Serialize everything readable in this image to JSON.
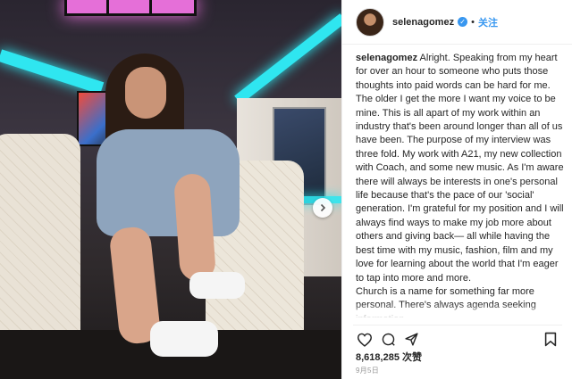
{
  "header": {
    "username": "selenagomez",
    "separator": "•",
    "follow_label": "关注"
  },
  "caption": {
    "username": "selenagomez",
    "paragraph1": "Alright. Speaking from my heart for over an hour to someone who puts those thoughts into paid words can be hard for me. The older I get the more I want my voice to be mine. This is all apart of my work within an industry that's been around longer than all of us have been. The purpose of my interview was three fold. My work with A21, my new collection with Coach, and some new music. As I'm aware there will always be interests in one's personal life because that's the pace of our 'social' generation. I'm grateful for my position and I will always find ways to make my job more about others and giving back— all while having the best time with my music, fashion, film and my love for learning about the world that I'm eager to tap into more and more.",
    "paragraph2": "Church is a name for something far more personal. There's always agenda seeking information . . ."
  },
  "stats": {
    "likes": "8,618,285 次赞",
    "date": "9月5日"
  },
  "icons": {
    "like": "heart-icon",
    "comment": "comment-icon",
    "share": "share-icon",
    "save": "bookmark-icon",
    "next": "chevron-right-icon",
    "verified": "verified-badge-icon"
  },
  "colors": {
    "link_blue": "#3897f0",
    "text": "#262626",
    "muted": "#999999"
  }
}
